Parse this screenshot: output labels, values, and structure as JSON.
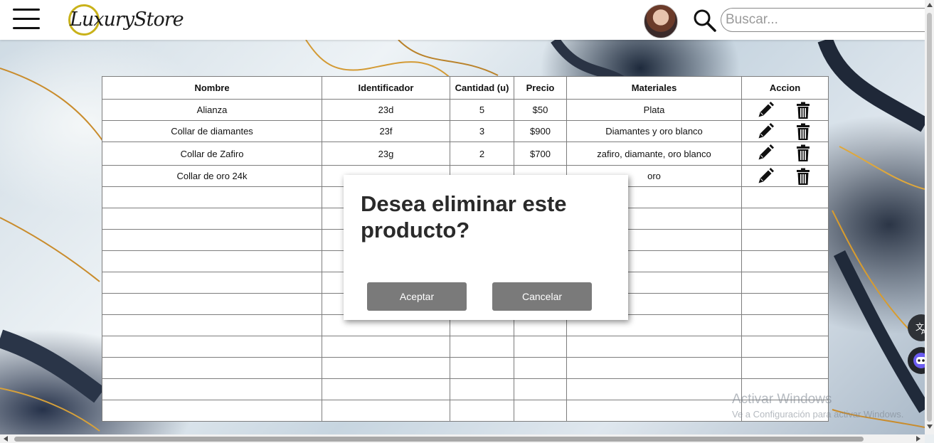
{
  "header": {
    "logo_text": "LuxuryStore",
    "search_placeholder": "Buscar..."
  },
  "table": {
    "columns": [
      "Nombre",
      "Identificador",
      "Cantidad (u)",
      "Precio",
      "Materiales",
      "Accion"
    ],
    "rows": [
      {
        "nombre": "Alianza",
        "identificador": "23d",
        "cantidad": "5",
        "precio": "$50",
        "materiales": "Plata"
      },
      {
        "nombre": "Collar de diamantes",
        "identificador": "23f",
        "cantidad": "3",
        "precio": "$900",
        "materiales": "Diamantes y oro blanco"
      },
      {
        "nombre": "Collar de Zafiro",
        "identificador": "23g",
        "cantidad": "2",
        "precio": "$700",
        "materiales": "zafiro, diamante, oro blanco"
      },
      {
        "nombre": "Collar de oro 24k",
        "identificador": "",
        "cantidad": "",
        "precio": "",
        "materiales": "oro"
      }
    ],
    "empty_row_count": 11
  },
  "modal": {
    "title": "Desea eliminar este producto?",
    "accept_label": "Aceptar",
    "cancel_label": "Cancelar"
  },
  "watermark": {
    "title": "Activar Windows",
    "subtitle": "Ve a Configuración para activar Windows."
  },
  "colors": {
    "modal_button": "#7a7a7a",
    "logo_ring": "#c9b21a"
  }
}
